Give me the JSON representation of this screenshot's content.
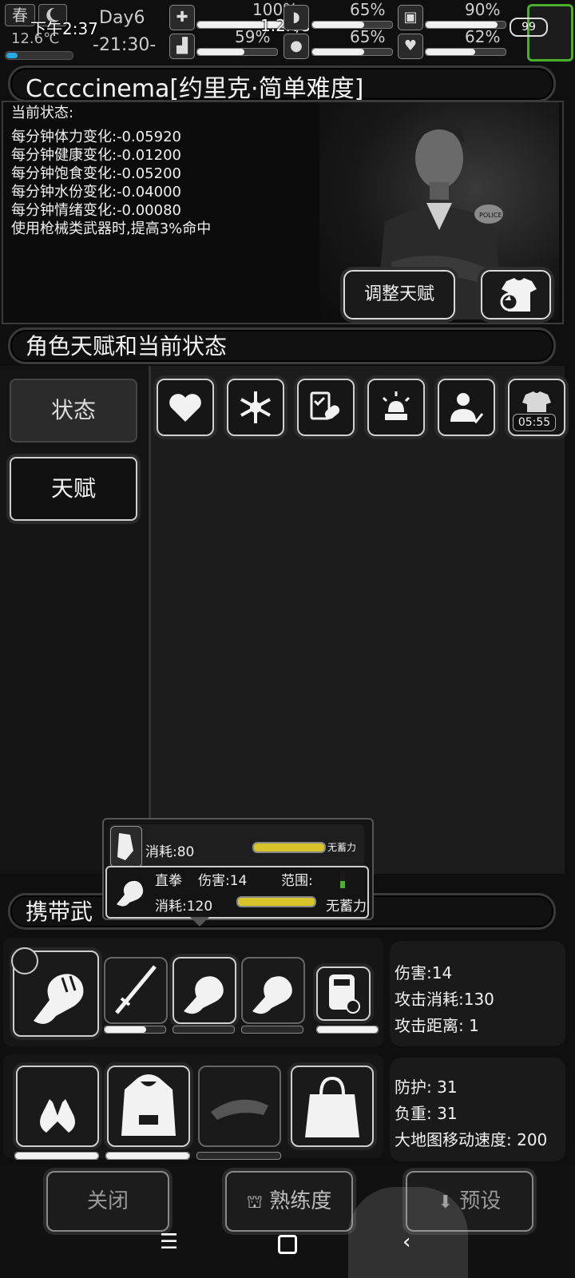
{
  "topbar": {
    "season": "春",
    "temperature": "12.6℃",
    "temperature_level": 0.15,
    "day": "Day6",
    "clock": "-21:30-",
    "system_time": "下午2:37",
    "network_speed": "1.2K/s",
    "battery": "99",
    "stats": [
      {
        "icon": "medkit-icon",
        "pct": "100%",
        "level": 1.0
      },
      {
        "icon": "stomach-icon",
        "pct": "65%",
        "level": 0.65
      },
      {
        "icon": "lock-icon",
        "pct": "90%",
        "level": 0.9
      },
      {
        "icon": "boot-icon",
        "pct": "59%",
        "level": 0.59
      },
      {
        "icon": "water-drop-icon",
        "pct": "65%",
        "level": 0.65
      },
      {
        "icon": "heart-icon",
        "pct": "62%",
        "level": 0.62
      }
    ]
  },
  "character": {
    "title": "Cccccinema[约里克·简单难度]",
    "status_heading": "当前状态:",
    "status_lines": [
      "每分钟体力变化:-0.05920",
      "每分钟健康变化:-0.01200",
      "每分钟饱食变化:-0.05200",
      "每分钟水份变化:-0.04000",
      "每分钟情绪变化:-0.00080",
      "使用枪械类武器时,提高3%命中"
    ],
    "adjust_talent_button": "调整天赋",
    "change_outfit_icon": "shirt-refresh-icon",
    "portrait_badge": "POLICE"
  },
  "talent_section": {
    "title": "角色天赋和当前状态",
    "tabs": [
      "状态",
      "天赋"
    ],
    "status_icons": [
      "heart-icon",
      "snowflake-icon",
      "medical-checklist-icon",
      "alarm-light-icon",
      "person-health-icon",
      "wet-clothes-icon"
    ],
    "timer": "05:55"
  },
  "weapon_popup": {
    "row1": {
      "cost": "消耗:80",
      "charge": "无蓄力"
    },
    "row2": {
      "name": "直拳",
      "damage": "伤害:14",
      "range": "范围:",
      "cost": "消耗:120",
      "charge": "无蓄力"
    }
  },
  "carry_section": {
    "title": "携带武",
    "weapon_stats": [
      "伤害:14",
      "攻击消耗:130",
      "攻击距离: 1"
    ],
    "armor_stats": [
      "防护: 31",
      "负重: 31",
      "大地图移动速度: 200"
    ]
  },
  "bottom": {
    "close": "关闭",
    "proficiency": "熟练度",
    "preset": "预设"
  }
}
